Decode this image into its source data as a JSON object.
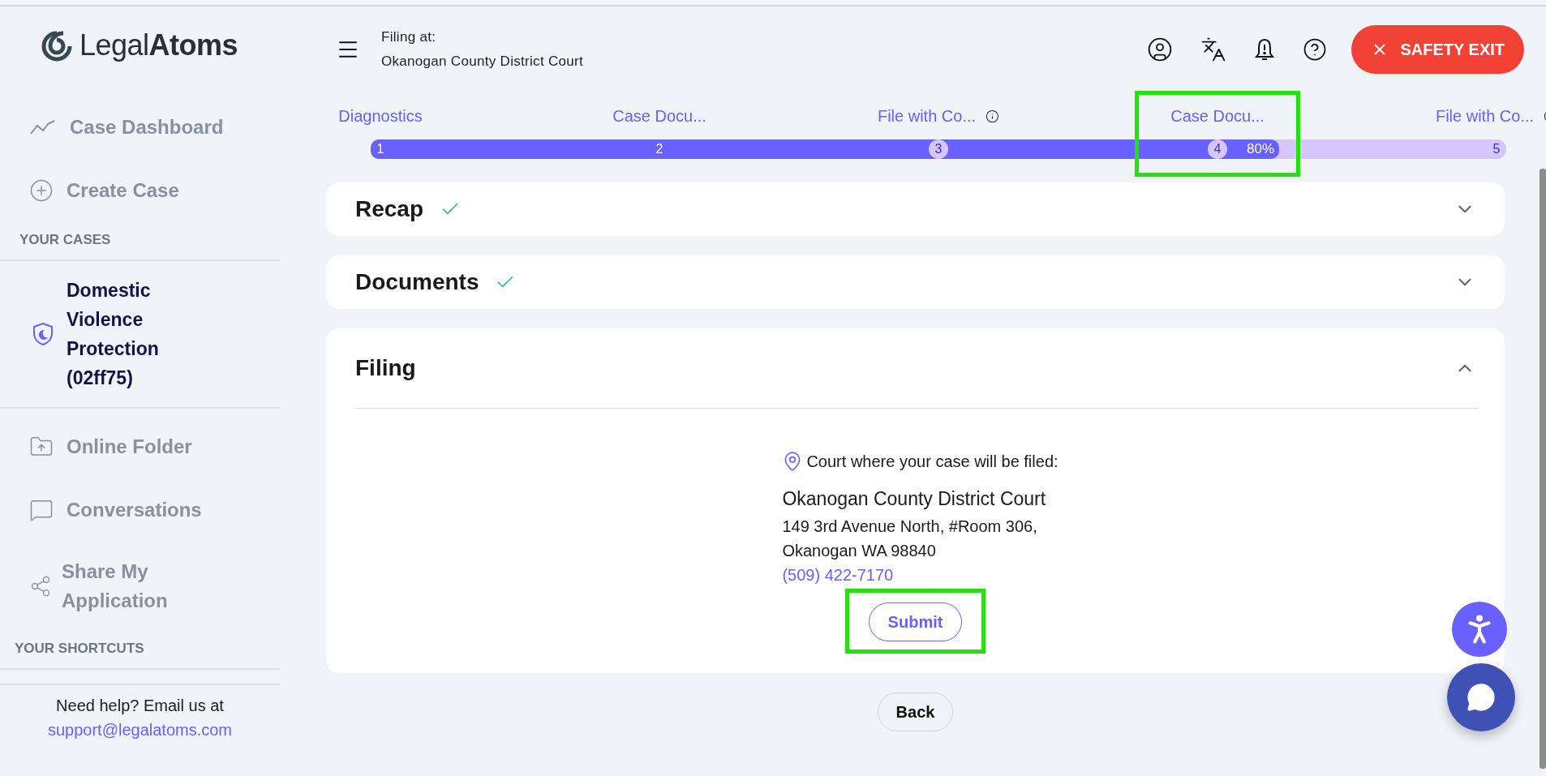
{
  "logo": "Legal**Atoms**",
  "sidebar": {
    "nav": [
      {
        "label": "Case Dashboard"
      },
      {
        "label": "Create Case"
      }
    ],
    "cases_heading": "YOUR CASES",
    "cases": [
      {
        "label": "Domestic Violence Protection (02ff75)"
      }
    ],
    "tools": [
      {
        "label": "Online Folder"
      },
      {
        "label": "Conversations"
      },
      {
        "label": "Share My Application"
      }
    ],
    "shortcuts_heading": "YOUR SHORTCUTS",
    "help": {
      "text": "Need help? Email us at",
      "email": "support@legalatoms.com"
    }
  },
  "header": {
    "filing_label": "Filing at:",
    "court": "Okanogan County District Court",
    "safety_exit": "SAFETY EXIT"
  },
  "progress": {
    "level": 0.8,
    "reading": "80%",
    "steps": [
      {
        "label": "Diagnostics",
        "number": "1",
        "done": true,
        "info": false,
        "highlighted": false
      },
      {
        "label": "Case Docu...",
        "number": "2",
        "done": true,
        "info": false,
        "highlighted": false
      },
      {
        "label": "File with Co...",
        "number": "3",
        "done": false,
        "info": true,
        "highlighted": false
      },
      {
        "label": "Case Docu...",
        "number": "4",
        "done": false,
        "info": false,
        "highlighted": true
      },
      {
        "label": "File with Co...",
        "number": "5",
        "done": false,
        "info": true,
        "highlighted": false
      }
    ]
  },
  "sections": [
    {
      "title": "Recap",
      "done": true,
      "expanded": false
    },
    {
      "title": "Documents",
      "done": true,
      "expanded": false
    },
    {
      "title": "Filing",
      "done": false,
      "expanded": true
    }
  ],
  "filing": {
    "heading": "Court where your case will be filed:",
    "court": "Okanogan County District Court",
    "address": [
      "149 3rd Avenue North, #Room 306,",
      "Okanogan WA 98840"
    ],
    "phone": "(509) 422-7170",
    "submit": {
      "label": "Submit",
      "highlighted": true
    }
  },
  "back": "Back"
}
